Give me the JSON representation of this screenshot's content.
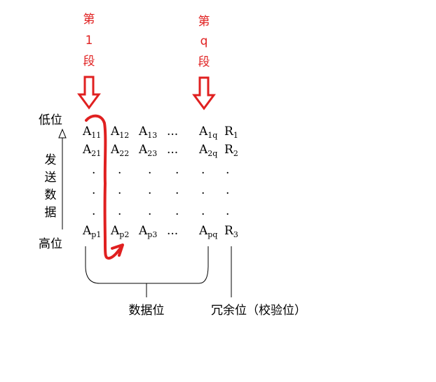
{
  "segment_first": {
    "line1": "第",
    "line2": "1",
    "line3": "段"
  },
  "segment_last": {
    "line1": "第",
    "line2": "q",
    "line3": "段"
  },
  "axis": {
    "low": "低位",
    "high": "高位",
    "send_label": [
      "发",
      "送",
      "数",
      "据"
    ]
  },
  "matrix": {
    "rows": [
      {
        "cells": [
          {
            "base": "A",
            "sub": "11"
          },
          {
            "base": "A",
            "sub": "12"
          },
          {
            "base": "A",
            "sub": "13"
          },
          {
            "base": "...",
            "sub": ""
          },
          {
            "base": "A",
            "sub": "1q"
          }
        ],
        "redundant": {
          "base": "R",
          "sub": "1"
        }
      },
      {
        "cells": [
          {
            "base": "A",
            "sub": "21"
          },
          {
            "base": "A",
            "sub": "22"
          },
          {
            "base": "A",
            "sub": "23"
          },
          {
            "base": "...",
            "sub": ""
          },
          {
            "base": "A",
            "sub": "2q"
          }
        ],
        "redundant": {
          "base": "R",
          "sub": "2"
        }
      },
      {
        "cells": [
          {
            "base": "A",
            "sub": "p1"
          },
          {
            "base": "A",
            "sub": "p2"
          },
          {
            "base": "A",
            "sub": "p3"
          },
          {
            "base": "...",
            "sub": ""
          },
          {
            "base": "A",
            "sub": "pq"
          }
        ],
        "redundant": {
          "base": "R",
          "sub": "3"
        }
      }
    ],
    "dot": "."
  },
  "labels": {
    "data_bits": "数据位",
    "redundant_bits": "冗余位（校验位）"
  },
  "colors": {
    "accent": "#e02020",
    "ink": "#000000"
  }
}
